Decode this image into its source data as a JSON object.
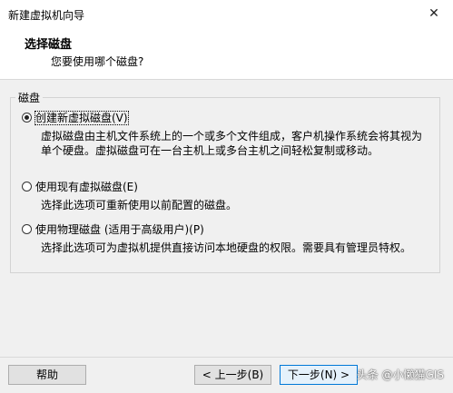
{
  "window": {
    "title": "新建虚拟机向导",
    "close_glyph": "✕"
  },
  "header": {
    "heading": "选择磁盘",
    "subheading": "您要使用哪个磁盘?"
  },
  "group": {
    "label": "磁盘"
  },
  "options": [
    {
      "label": "创建新虚拟磁盘(V)",
      "checked": true,
      "description": [
        "虚拟磁盘由主机文件系统上的一个或多个文件组成，客户机操作系统会将其视为",
        "单个硬盘。虚拟磁盘可在一台主机上或多台主机之间轻松复制或移动。"
      ]
    },
    {
      "label": "使用现有虚拟磁盘(E)",
      "checked": false,
      "description": [
        "选择此选项可重新使用以前配置的磁盘。"
      ]
    },
    {
      "label": "使用物理磁盘 (适用于高级用户)(P)",
      "checked": false,
      "description": [
        "选择此选项可为虚拟机提供直接访问本地硬盘的权限。需要具有管理员特权。"
      ]
    }
  ],
  "buttons": {
    "help": "帮助",
    "back": "< 上一步(B)",
    "next": "下一步(N) >"
  },
  "watermark": "头条 @小懒猫GIS"
}
